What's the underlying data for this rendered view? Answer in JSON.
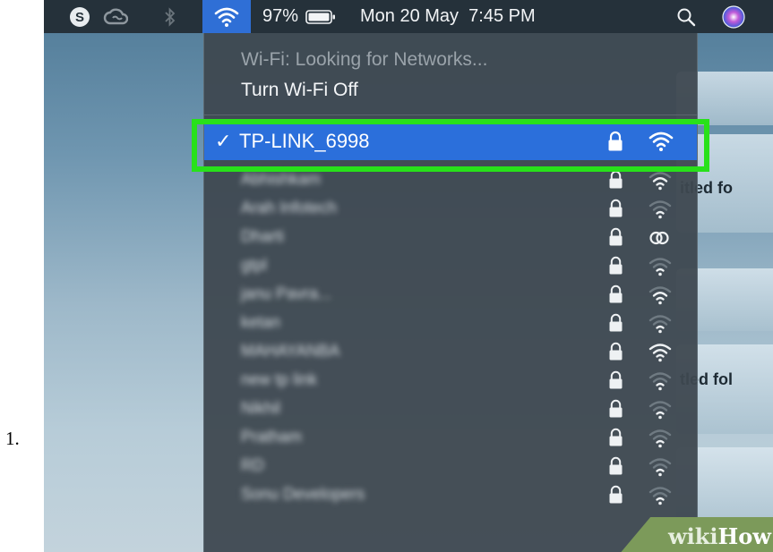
{
  "step": {
    "number": "1."
  },
  "menubar": {
    "battery_percent": "97%",
    "datetime": "Mon 20 May  7:45 PM",
    "icons": [
      "skype-icon",
      "creative-cloud-icon",
      "bluetooth-icon",
      "wifi-icon",
      "battery-icon",
      "spotlight-search-icon",
      "siri-icon"
    ],
    "colors": {
      "bar": "#25313a",
      "wifi_active": "#2f6fd6"
    }
  },
  "wifi_menu": {
    "status": "Wi-Fi: Looking for Networks...",
    "toggle_label": "Turn Wi-Fi Off",
    "selected_network": {
      "checkmark": "✓",
      "ssid": "TP-LINK_6998",
      "secured": true,
      "signal": "strong"
    },
    "other_networks": [
      {
        "ssid": "Abhishkam",
        "secured": true,
        "signal": "medium"
      },
      {
        "ssid": "Arah Infotech",
        "secured": true,
        "signal": "weak"
      },
      {
        "ssid": "Dharti",
        "secured": true,
        "signal": "personal-hotspot"
      },
      {
        "ssid": "gtpl",
        "secured": true,
        "signal": "weak"
      },
      {
        "ssid": "janu Pavra...",
        "secured": true,
        "signal": "medium"
      },
      {
        "ssid": "ketan",
        "secured": true,
        "signal": "weak"
      },
      {
        "ssid": "MAHAYANBA",
        "secured": true,
        "signal": "strong"
      },
      {
        "ssid": "new tp link",
        "secured": true,
        "signal": "weak"
      },
      {
        "ssid": "Nikhil",
        "secured": true,
        "signal": "weak"
      },
      {
        "ssid": "Pratham",
        "secured": true,
        "signal": "weak"
      },
      {
        "ssid": "RD",
        "secured": true,
        "signal": "weak"
      },
      {
        "ssid": "Sonu Developers",
        "secured": true,
        "signal": "weak"
      }
    ],
    "highlight_color": "#28e11a"
  },
  "desktop": {
    "folder_labels": [
      "itled fo",
      "tled fol"
    ]
  },
  "watermark": {
    "wiki": "wiki",
    "how": "How"
  }
}
